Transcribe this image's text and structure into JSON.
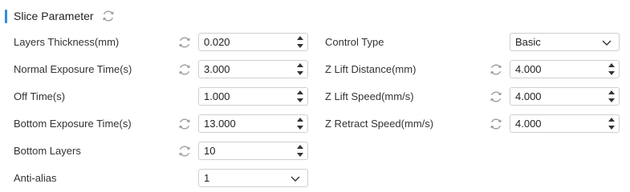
{
  "section": {
    "title": "Slice Parameter"
  },
  "left": {
    "layers_thickness": {
      "label": "Layers Thickness(mm)",
      "value": "0.020"
    },
    "normal_exposure": {
      "label": "Normal Exposure Time(s)",
      "value": "3.000"
    },
    "off_time": {
      "label": "Off Time(s)",
      "value": "1.000"
    },
    "bottom_exposure": {
      "label": "Bottom Exposure Time(s)",
      "value": "13.000"
    },
    "bottom_layers": {
      "label": "Bottom Layers",
      "value": "10"
    },
    "anti_alias": {
      "label": "Anti-alias",
      "value": "1"
    }
  },
  "right": {
    "control_type": {
      "label": "Control Type",
      "value": "Basic"
    },
    "z_lift_distance": {
      "label": "Z Lift Distance(mm)",
      "value": "4.000"
    },
    "z_lift_speed": {
      "label": "Z Lift Speed(mm/s)",
      "value": "4.000"
    },
    "z_retract_speed": {
      "label": "Z Retract Speed(mm/s)",
      "value": "4.000"
    }
  },
  "icons": {
    "refresh": "refresh-icon",
    "spinner_up": "chevron-up-icon",
    "spinner_down": "chevron-down-icon",
    "dropdown": "chevron-down-icon"
  },
  "colors": {
    "accent": "#2f8fdc",
    "border": "#cfcfcf",
    "icon_gray": "#9a9a9a"
  }
}
